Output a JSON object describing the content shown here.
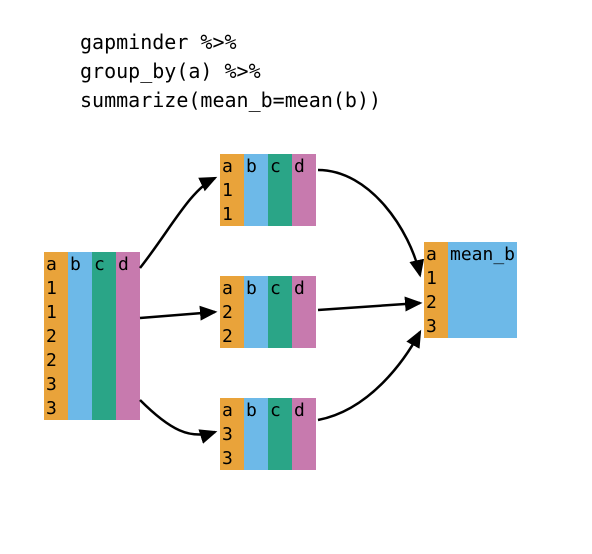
{
  "code": {
    "line1": "gapminder %>%",
    "line2": "group_by(a) %>%",
    "line3": "summarize(mean_b=mean(b))"
  },
  "columns": {
    "a": "a",
    "b": "b",
    "c": "c",
    "d": "d",
    "mean_b": "mean_b"
  },
  "source": {
    "rows": [
      {
        "a": "1"
      },
      {
        "a": "1"
      },
      {
        "a": "2"
      },
      {
        "a": "2"
      },
      {
        "a": "3"
      },
      {
        "a": "3"
      }
    ]
  },
  "groups": [
    {
      "rows": [
        {
          "a": "1"
        },
        {
          "a": "1"
        }
      ]
    },
    {
      "rows": [
        {
          "a": "2"
        },
        {
          "a": "2"
        }
      ]
    },
    {
      "rows": [
        {
          "a": "3"
        },
        {
          "a": "3"
        }
      ]
    }
  ],
  "result": {
    "rows": [
      {
        "a": "1"
      },
      {
        "a": "2"
      },
      {
        "a": "3"
      }
    ]
  }
}
